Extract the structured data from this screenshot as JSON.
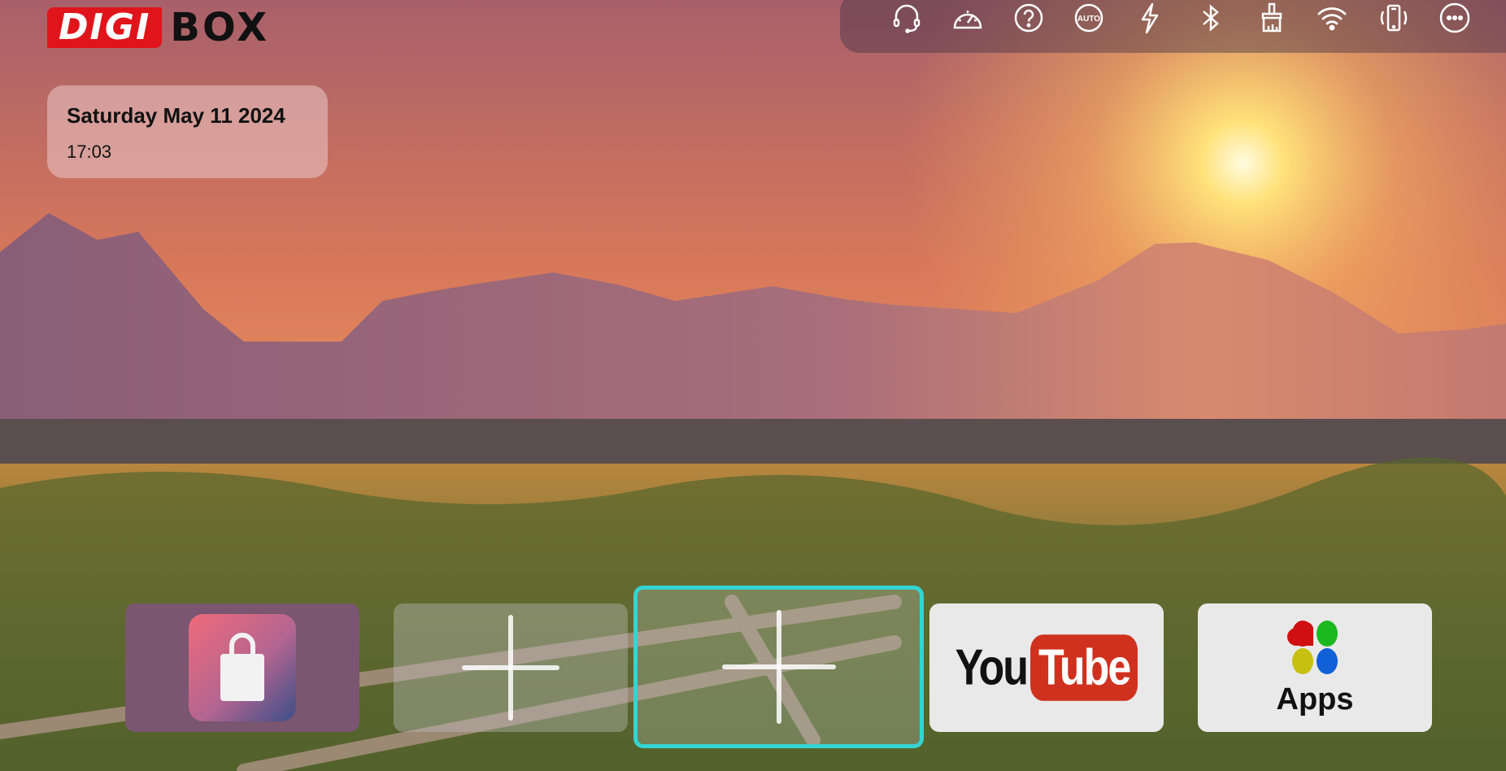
{
  "brand": {
    "logo_text_left": "DIGI",
    "logo_text_right": "BOX",
    "accent": "#e0141b"
  },
  "clock": {
    "date": "Saturday May 11 2024",
    "time": "17:03"
  },
  "status_icons": [
    {
      "name": "headset-icon"
    },
    {
      "name": "speedometer-icon"
    },
    {
      "name": "help-icon"
    },
    {
      "name": "auto-icon",
      "label": "AUTO"
    },
    {
      "name": "lightning-icon"
    },
    {
      "name": "bluetooth-icon"
    },
    {
      "name": "brush-icon"
    },
    {
      "name": "wifi-icon"
    },
    {
      "name": "phone-vibrate-icon"
    },
    {
      "name": "more-icon"
    }
  ],
  "tiles": [
    {
      "name": "store",
      "icon": "shopping-bag-icon"
    },
    {
      "name": "add-shortcut-1",
      "icon": "plus-icon"
    },
    {
      "name": "add-shortcut-2",
      "icon": "plus-icon",
      "focused": true,
      "focus_color": "#35d4d2"
    },
    {
      "name": "youtube",
      "label_you": "You",
      "label_tube": "Tube"
    },
    {
      "name": "apps",
      "label": "Apps"
    }
  ]
}
